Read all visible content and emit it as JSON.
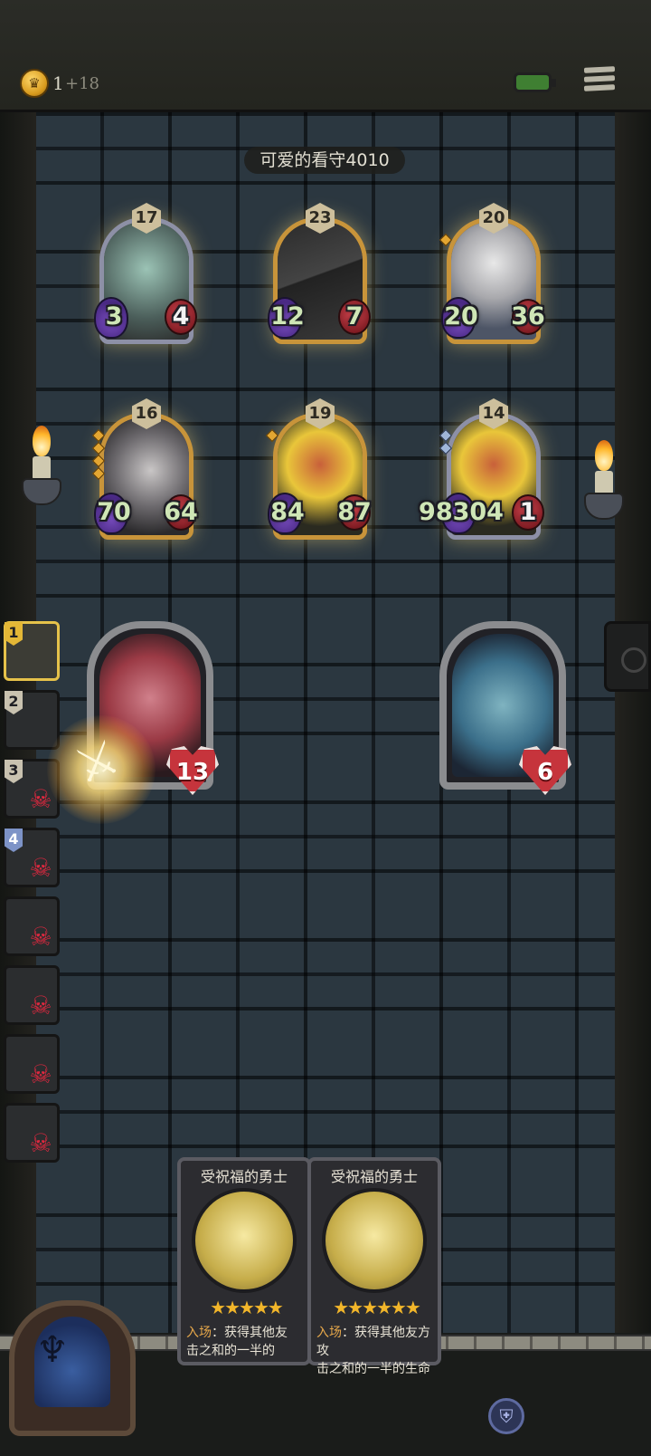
{
  "topbar": {
    "coin_icon": "gold-coin-icon",
    "gold": "1",
    "gold_income": "+18",
    "battery_color": "#3f7f32",
    "menu_icon": "hamburger-menu-icon"
  },
  "opponent": {
    "name": "可爱的看守4010"
  },
  "enemy_units": [
    {
      "tier": "17",
      "attack": "3",
      "health": "4",
      "frame": "silver",
      "portrait": "horned-beast"
    },
    {
      "tier": "23",
      "attack": "12",
      "health": "7",
      "frame": "gold",
      "portrait": "shield-warrior"
    },
    {
      "tier": "20",
      "attack": "20",
      "health": "36",
      "frame": "gold",
      "portrait": "armored-knight"
    },
    {
      "tier": "16",
      "attack": "70",
      "health": "64",
      "frame": "gold",
      "portrait": "horned-demon"
    },
    {
      "tier": "19",
      "attack": "84",
      "health": "87",
      "frame": "gold",
      "portrait": "sun-mage"
    },
    {
      "tier": "14",
      "attack": "98304",
      "health": "1",
      "frame": "silver",
      "portrait": "sun-mage"
    }
  ],
  "heroes": {
    "left": {
      "health": "13",
      "portrait": "pirate-rat"
    },
    "right": {
      "health": "6",
      "portrait": "blue-medusa"
    }
  },
  "turn_queue": [
    {
      "number": "1",
      "state": "active"
    },
    {
      "number": "2",
      "state": "alive"
    },
    {
      "number": "3",
      "state": "dead"
    },
    {
      "number": "4",
      "state": "dead"
    },
    {
      "number": "",
      "state": "dead"
    },
    {
      "number": "",
      "state": "dead"
    },
    {
      "number": "",
      "state": "dead"
    },
    {
      "number": "",
      "state": "dead"
    }
  ],
  "hand": [
    {
      "title": "受祝福的勇士",
      "stars": "★★★★★",
      "keyword": "入场",
      "text": "：获得其他友",
      "text2": "击之和的一半的"
    },
    {
      "title": "受祝福的勇士",
      "stars": "★★★★★★",
      "keyword": "入场",
      "text": "：获得其他友方攻",
      "text2": "击之和的一半的生命"
    }
  ],
  "icons": {
    "attack_effect": "sword-icon",
    "skull": "skull-icon",
    "shield": "shield-icon",
    "portal": "portal-icon"
  }
}
